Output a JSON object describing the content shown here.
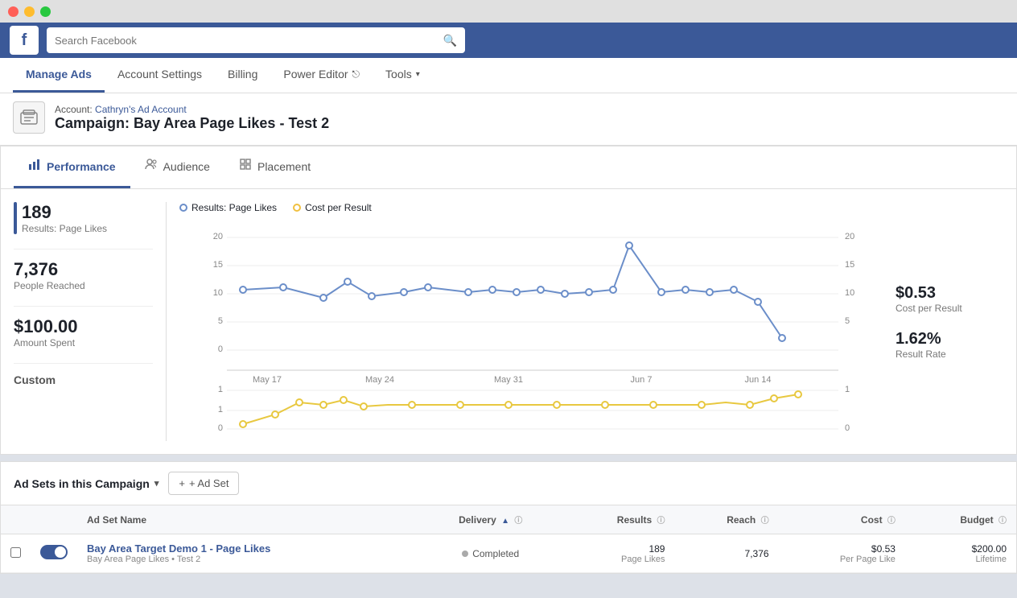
{
  "titlebar": {
    "close": "close",
    "minimize": "minimize",
    "maximize": "maximize"
  },
  "header": {
    "logo": "f",
    "search_placeholder": "Search Facebook"
  },
  "nav": {
    "items": [
      {
        "id": "manage-ads",
        "label": "Manage Ads",
        "active": true
      },
      {
        "id": "account-settings",
        "label": "Account Settings",
        "active": false
      },
      {
        "id": "billing",
        "label": "Billing",
        "active": false
      },
      {
        "id": "power-editor",
        "label": "Power Editor",
        "active": false,
        "icon": "⎋"
      },
      {
        "id": "tools",
        "label": "Tools",
        "active": false,
        "dropdown": true
      }
    ]
  },
  "breadcrumb": {
    "account_prefix": "Account:",
    "account_name": "Cathryn's Ad Account",
    "campaign_prefix": "Campaign",
    "campaign_name": "Bay Area Page Likes - Test 2"
  },
  "tabs": [
    {
      "id": "performance",
      "label": "Performance",
      "icon": "📊",
      "active": true
    },
    {
      "id": "audience",
      "label": "Audience",
      "icon": "👥",
      "active": false
    },
    {
      "id": "placement",
      "label": "Placement",
      "icon": "📋",
      "active": false
    }
  ],
  "stats": {
    "results_value": "189",
    "results_label": "Results: Page Likes",
    "people_reached_value": "7,376",
    "people_reached_label": "People Reached",
    "amount_spent_value": "$100.00",
    "amount_spent_label": "Amount Spent",
    "custom_label": "Custom"
  },
  "chart": {
    "legend": [
      {
        "id": "results",
        "label": "Results: Page Likes",
        "color": "blue"
      },
      {
        "id": "cost",
        "label": "Cost per Result",
        "color": "yellow"
      }
    ],
    "x_labels": [
      "May 17",
      "May 24",
      "May 31",
      "Jun 7",
      "Jun 14"
    ],
    "y_left_max": "20",
    "y_left_mid": "15",
    "y_left_low": "10",
    "y_left_5": "5",
    "y_right_max": "20",
    "y_right_mid": "15",
    "y_right_low": "10",
    "y_right_5": "5",
    "y_bottom_1": "1",
    "y_bottom_0": "0"
  },
  "right_metrics": {
    "cost_per_result_value": "$0.53",
    "cost_per_result_label": "Cost per Result",
    "result_rate_value": "1.62%",
    "result_rate_label": "Result Rate"
  },
  "adsets": {
    "title": "Ad Sets in this Campaign",
    "add_btn": "+ Ad Set",
    "columns": [
      {
        "id": "checkbox",
        "label": ""
      },
      {
        "id": "toggle",
        "label": ""
      },
      {
        "id": "name",
        "label": "Ad Set Name"
      },
      {
        "id": "delivery",
        "label": "Delivery",
        "sortable": true,
        "info": true
      },
      {
        "id": "results",
        "label": "Results",
        "info": true
      },
      {
        "id": "reach",
        "label": "Reach",
        "info": true
      },
      {
        "id": "cost",
        "label": "Cost",
        "info": true
      },
      {
        "id": "budget",
        "label": "Budget",
        "info": true
      }
    ],
    "rows": [
      {
        "id": "row-1",
        "name": "Bay Area Target Demo 1 - Page Likes",
        "campaign": "Bay Area Page Likes • Test 2",
        "delivery": "Completed",
        "delivery_dot": "grey",
        "results_value": "189",
        "results_label": "Page Likes",
        "reach": "7,376",
        "cost_value": "$0.53",
        "cost_label": "Per Page Like",
        "budget_value": "$200.00",
        "budget_label": "Lifetime",
        "enabled": true
      }
    ]
  }
}
